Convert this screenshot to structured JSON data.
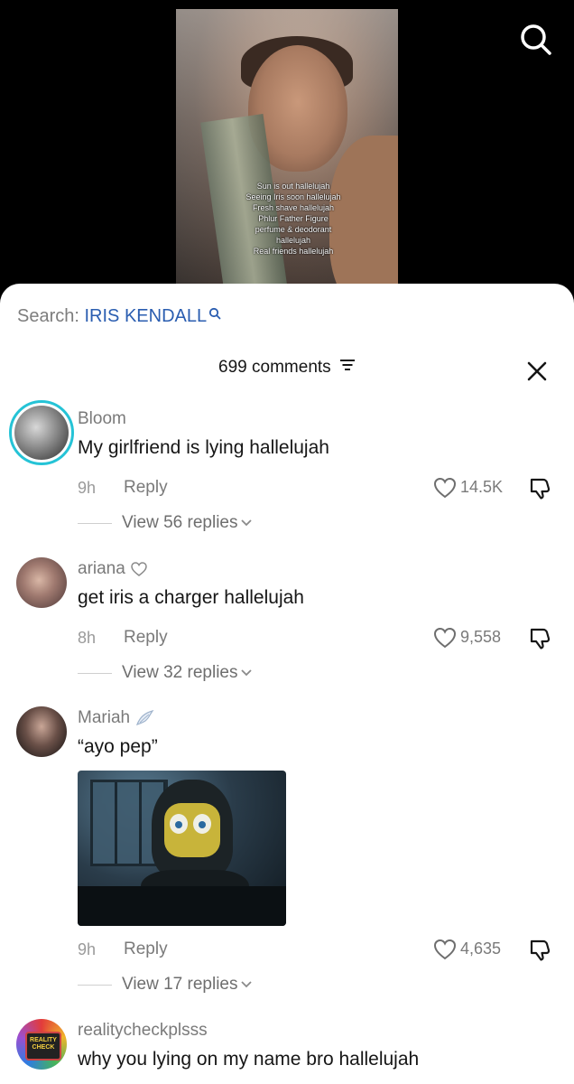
{
  "video": {
    "overlay_lines": [
      "Sun is out hallelujah",
      "Seeing Iris soon hallelujah",
      "Fresh shave hallelujah",
      "Phlur Father Figure",
      "perfume & deodorant",
      "hallelujah",
      "Real friends hallelujah"
    ]
  },
  "search": {
    "prefix": "Search:",
    "term": "IRIS KENDALL"
  },
  "header": {
    "count_label": "699 comments"
  },
  "comments": [
    {
      "username": "Bloom",
      "text": "My girlfriend is lying hallelujah",
      "time": "9h",
      "reply": "Reply",
      "likes": "14.5K",
      "view_replies": "View 56 replies"
    },
    {
      "username": "ariana",
      "text": "get iris a charger hallelujah",
      "time": "8h",
      "reply": "Reply",
      "likes": "9,558",
      "view_replies": "View 32 replies"
    },
    {
      "username": "Mariah",
      "text": "“ayo pep”",
      "time": "9h",
      "reply": "Reply",
      "likes": "4,635",
      "view_replies": "View 17 replies"
    },
    {
      "username": "realitycheckplsss",
      "text": "why you lying on my name bro hallelujah",
      "avatar_text": "REALITY CHECK"
    }
  ],
  "colors": {
    "accent_link": "#2a5db0",
    "ring": "#25c3d6"
  }
}
